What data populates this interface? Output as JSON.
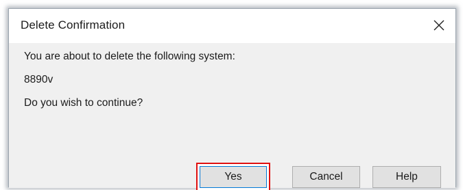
{
  "dialog": {
    "title": "Delete Confirmation",
    "close_icon": "close-icon",
    "message": {
      "line1": "You are about to delete the following system:",
      "system_name": "8890v",
      "line3": "Do you wish to continue?"
    },
    "buttons": {
      "yes_label": "Yes",
      "cancel_label": "Cancel",
      "help_label": "Help"
    },
    "highlight_color": "#e01010",
    "default_button_border": "#0078d7"
  }
}
